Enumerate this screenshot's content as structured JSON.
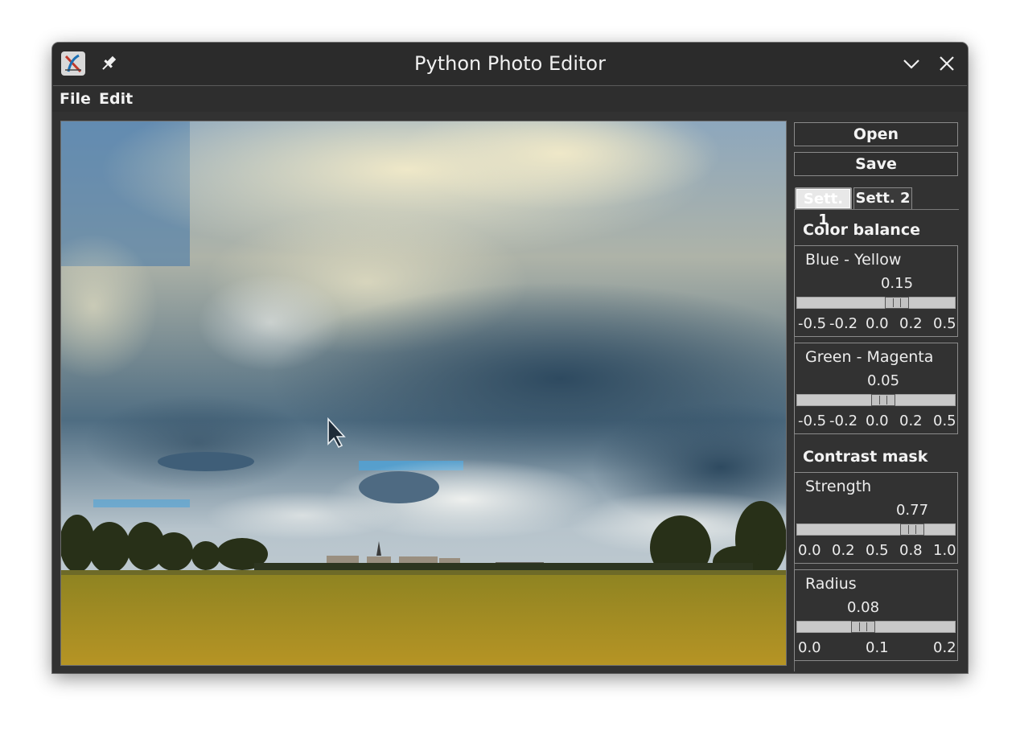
{
  "window": {
    "title": "Python Photo Editor",
    "app_icon": "x-app-icon",
    "pin_icon": "pin-icon",
    "minimize_icon": "chevron-down-icon",
    "close_icon": "close-icon"
  },
  "menu": {
    "file": "File",
    "edit": "Edit"
  },
  "sidebar": {
    "open_label": "Open",
    "save_label": "Save",
    "tabs": [
      {
        "label": "Sett. 1",
        "selected": true
      },
      {
        "label": "Sett. 2",
        "selected": false
      }
    ],
    "color_balance": {
      "title": "Color balance",
      "sliders": [
        {
          "label": "Blue - Yellow",
          "value": "0.15",
          "min": -0.5,
          "max": 0.5,
          "current": 0.15,
          "ticks": [
            "-0.5",
            "-0.2",
            "0.0",
            "0.2",
            "0.5"
          ]
        },
        {
          "label": "Green - Magenta",
          "value": "0.05",
          "min": -0.5,
          "max": 0.5,
          "current": 0.05,
          "ticks": [
            "-0.5",
            "-0.2",
            "0.0",
            "0.2",
            "0.5"
          ]
        }
      ]
    },
    "contrast_mask": {
      "title": "Contrast mask",
      "sliders": [
        {
          "label": "Strength",
          "value": "0.77",
          "min": 0.0,
          "max": 1.0,
          "current": 0.77,
          "ticks": [
            "0.0",
            "0.2",
            "0.5",
            "0.8",
            "1.0"
          ]
        },
        {
          "label": "Radius",
          "value": "0.08",
          "min": 0.0,
          "max": 0.2,
          "current": 0.08,
          "ticks": [
            "0.0",
            "0.1",
            "0.2"
          ]
        }
      ]
    }
  },
  "colors": {
    "window_bg": "#2d2d2d",
    "text": "#f0f0f0",
    "trough": "#c9c9c9"
  }
}
